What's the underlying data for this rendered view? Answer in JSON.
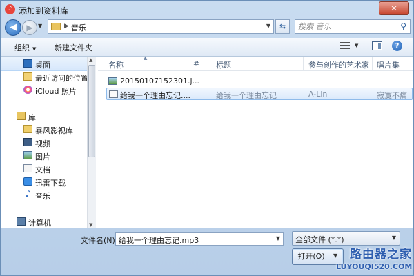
{
  "window": {
    "title": "添加到资料库",
    "app_icon_glyph": "♪",
    "close_glyph": "✕"
  },
  "address": {
    "path": "音乐",
    "search_placeholder": "搜索 音乐"
  },
  "toolbar": {
    "organize": "组织",
    "new_folder": "新建文件夹"
  },
  "nav": {
    "items": [
      {
        "label": "桌面",
        "icon": "desktop-icon",
        "selected": true
      },
      {
        "label": "最近访问的位置",
        "icon": "recent-places-icon"
      },
      {
        "label": "iCloud 照片",
        "icon": "icloud-photos-icon"
      },
      {
        "label": "库",
        "icon": "library-icon",
        "group": true
      },
      {
        "label": "暴风影视库",
        "icon": "folder-icon"
      },
      {
        "label": "视频",
        "icon": "video-icon"
      },
      {
        "label": "图片",
        "icon": "pictures-icon"
      },
      {
        "label": "文档",
        "icon": "documents-icon"
      },
      {
        "label": "迅雷下载",
        "icon": "download-icon"
      },
      {
        "label": "音乐",
        "icon": "music-icon"
      },
      {
        "label": "计算机",
        "icon": "computer-icon",
        "group": true
      }
    ]
  },
  "columns": {
    "name": "名称",
    "number": "#",
    "title": "标题",
    "artist": "参与创作的艺术家",
    "album": "唱片集"
  },
  "files": [
    {
      "name": "20150107152301.j...",
      "number": "",
      "title": "",
      "artist": "",
      "album": "",
      "icon": "image-file-icon"
    },
    {
      "name": "给我一个理由忘记....",
      "number": "",
      "title": "给我一个理由忘记",
      "artist": "A-Lin",
      "album": "寂寞不痛",
      "icon": "mp3-file-icon",
      "selected": true
    }
  ],
  "bottom": {
    "filename_label": "文件名(N):",
    "filename_value": "给我一个理由忘记.mp3",
    "filetype_value": "全部文件 (*.*)",
    "open_button": "打开(O)"
  },
  "watermark": {
    "cn": "路由器之家",
    "en": "LUYOUQI520.COM"
  }
}
